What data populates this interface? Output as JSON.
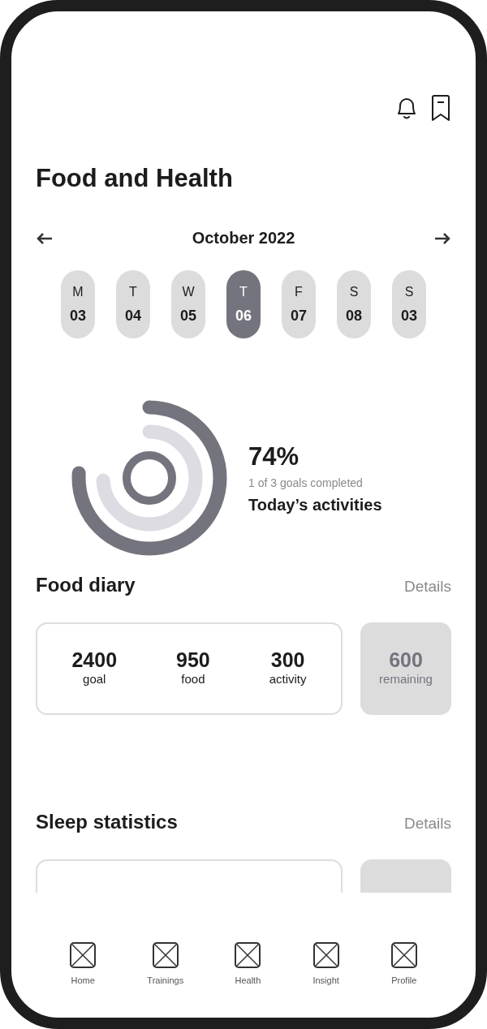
{
  "title": "Food and Health",
  "calendar": {
    "month": "October 2022",
    "days": [
      {
        "weekday": "M",
        "date": "03",
        "selected": false
      },
      {
        "weekday": "T",
        "date": "04",
        "selected": false
      },
      {
        "weekday": "W",
        "date": "05",
        "selected": false
      },
      {
        "weekday": "T",
        "date": "06",
        "selected": true
      },
      {
        "weekday": "F",
        "date": "07",
        "selected": false
      },
      {
        "weekday": "S",
        "date": "08",
        "selected": false
      },
      {
        "weekday": "S",
        "date": "03",
        "selected": false
      }
    ]
  },
  "activity": {
    "rings": [
      {
        "level": 0.76,
        "color": "#74747e"
      },
      {
        "level": 0.74,
        "color": "#dcdce2"
      },
      {
        "level": 1,
        "color": "#74747e"
      }
    ],
    "percent": "74%",
    "subtitle": "1 of 3 goals completed",
    "label": "Today’s activities"
  },
  "food_diary": {
    "title": "Food diary",
    "link": "Details",
    "stats": [
      {
        "value": "2400",
        "label": "goal"
      },
      {
        "value": "950",
        "label": "food"
      },
      {
        "value": "300",
        "label": "activity"
      }
    ],
    "remaining": {
      "value": "600",
      "label": "remaining"
    }
  },
  "sleep_statistics": {
    "title": "Sleep statistics",
    "link": "Details"
  },
  "nav": [
    {
      "label": "Home"
    },
    {
      "label": "Trainings"
    },
    {
      "label": "Health"
    },
    {
      "label": "Insight"
    },
    {
      "label": "Profile"
    }
  ]
}
